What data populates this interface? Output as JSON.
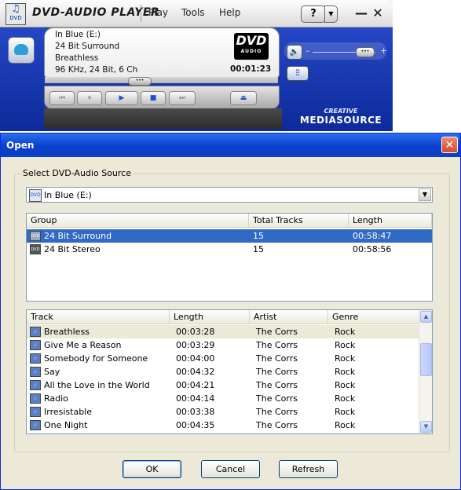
{
  "player": {
    "title": "DVD-AUDIO PLAYER",
    "menu": [
      "Play",
      "Tools",
      "Help"
    ],
    "help_button": "?",
    "minimize": "—",
    "close": "✕",
    "lcd": {
      "line1": "In Blue (E:)",
      "line2": "24 Bit Surround",
      "line3": "Breathless",
      "line4": "96 KHz, 24 Bit, 6 Ch",
      "time": "00:01:23",
      "logo_text": "DVD",
      "logo_sub": "AUDIO"
    },
    "transport": {
      "prev": "⏮",
      "pause": "⏸",
      "play": "▶",
      "stop": "■",
      "next": "⏭",
      "eject": "⏏"
    },
    "volume_level": 0.82,
    "volume_minus": "–",
    "volume_plus": "+",
    "brand_top": "CREATIVE",
    "brand_bottom": "MEDIASOURCE"
  },
  "dialog": {
    "title": "Open",
    "close": "✕",
    "group_label": "Select DVD-Audio Source",
    "source": "In Blue (E:)",
    "group_table": {
      "columns": [
        "Group",
        "Total Tracks",
        "Length"
      ],
      "rows": [
        {
          "group": "24 Bit Surround",
          "tracks": "15",
          "length": "00:58:47",
          "selected": true
        },
        {
          "group": "24 Bit Stereo",
          "tracks": "15",
          "length": "00:58:56",
          "selected": false
        }
      ]
    },
    "track_table": {
      "columns": [
        "Track",
        "Length",
        "Artist",
        "Genre"
      ],
      "rows": [
        {
          "track": "Breathless",
          "length": "00:03:28",
          "artist": "The Corrs",
          "genre": "Rock"
        },
        {
          "track": "Give Me a Reason",
          "length": "00:03:29",
          "artist": "The Corrs",
          "genre": "Rock"
        },
        {
          "track": "Somebody for Someone",
          "length": "00:04:00",
          "artist": "The Corrs",
          "genre": "Rock"
        },
        {
          "track": "Say",
          "length": "00:04:32",
          "artist": "The Corrs",
          "genre": "Rock"
        },
        {
          "track": "All the Love in the World",
          "length": "00:04:21",
          "artist": "The Corrs",
          "genre": "Rock"
        },
        {
          "track": "Radio",
          "length": "00:04:14",
          "artist": "The Corrs",
          "genre": "Rock"
        },
        {
          "track": "Irresistable",
          "length": "00:03:38",
          "artist": "The Corrs",
          "genre": "Rock"
        },
        {
          "track": "One Night",
          "length": "00:04:35",
          "artist": "The Corrs",
          "genre": "Rock"
        }
      ]
    },
    "buttons": {
      "ok": "OK",
      "cancel": "Cancel",
      "refresh": "Refresh"
    }
  },
  "colors": {
    "selection": "#316ac5",
    "titlebar": "#0a3fcb",
    "player_blue": "#1a3fc0"
  }
}
